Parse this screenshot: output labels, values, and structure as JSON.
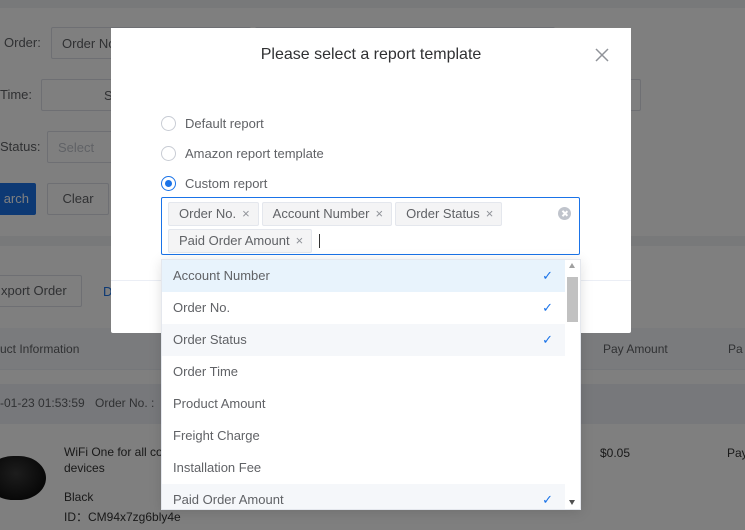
{
  "background": {
    "filters": {
      "order_label": "Order:",
      "order_input_value": "Order No.",
      "time_label": "Time:",
      "time_input_value": "S",
      "status_label": "Status:",
      "status_placeholder": "Select"
    },
    "buttons": {
      "search": "arch",
      "clear": "Clear",
      "export_order": "xport Order",
      "extra_link": "D"
    },
    "table": {
      "headers": [
        "uct Information",
        "Pay Amount",
        "Pa"
      ],
      "order_header": {
        "datetime": "-01-23 01:53:59",
        "order_no_label": "Order No. :"
      },
      "row": {
        "product_title_line1": "WiFi One for all co",
        "product_title_line2": "devices",
        "variant": "Black",
        "id_label": "ID：CM94x7zg6bly4e",
        "pay_amount": "$0.05",
        "pay_trunc": "Pay"
      }
    }
  },
  "dialog": {
    "title": "Please select a report template",
    "radios": [
      {
        "label": "Default report",
        "checked": false
      },
      {
        "label": "Amazon report template",
        "checked": false
      },
      {
        "label": "Custom report",
        "checked": true
      }
    ],
    "selected_tags": [
      "Order No.",
      "Account Number",
      "Order Status",
      "Paid Order Amount"
    ],
    "tag_close_glyph": "×"
  },
  "dropdown": {
    "check_glyph": "✓",
    "options": [
      {
        "label": "Account Number",
        "selected": true
      },
      {
        "label": "Order No.",
        "selected": true
      },
      {
        "label": "Order Status",
        "selected": true
      },
      {
        "label": "Order Time",
        "selected": false
      },
      {
        "label": "Product Amount",
        "selected": false
      },
      {
        "label": "Freight Charge",
        "selected": false
      },
      {
        "label": "Installation Fee",
        "selected": false
      },
      {
        "label": "Paid Order Amount",
        "selected": true
      }
    ]
  },
  "colors": {
    "primary": "#1a73e8",
    "hover_bg": "#e8f3fc",
    "overlay": "rgba(0,0,0,0.5)"
  },
  "icons": {
    "close": "close-icon",
    "clear": "clear-circle-icon",
    "check": "check-icon",
    "scroll_up": "scroll-up-arrow-icon",
    "scroll_down": "scroll-down-arrow-icon"
  }
}
